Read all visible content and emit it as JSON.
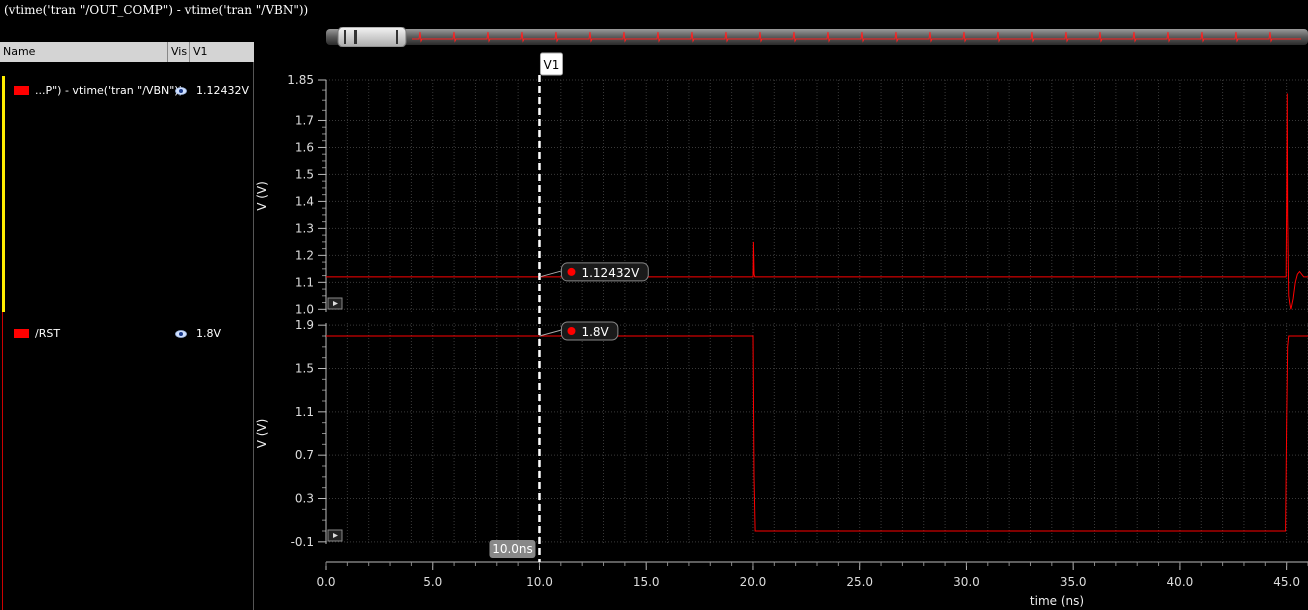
{
  "window": {
    "title": "(vtime('tran \"/OUT_COMP\") - vtime('tran \"/VBN\"))"
  },
  "browser": {
    "columns": [
      "Name",
      "Vis",
      "V1"
    ],
    "traces": [
      {
        "name": "...P\") - vtime('tran \"/VBN\"))",
        "value": "1.12432V",
        "color": "#ff0000",
        "visible_icon": "eye-icon"
      },
      {
        "name": "/RST",
        "value": "1.8V",
        "color": "#ff0000",
        "visible_icon": "eye-icon"
      }
    ]
  },
  "cursor": {
    "label": "V1",
    "time_label": "10.0ns",
    "time": 10.0,
    "readouts": [
      "1.12432V",
      "1.8V"
    ]
  },
  "colors": {
    "trace": "#ff0000",
    "grid": "#3a3a3a",
    "cursor": "#ffffff",
    "background": "#000000"
  },
  "chart_data": [
    {
      "type": "line",
      "ylabel": "V (V)",
      "xlim": [
        0,
        46
      ],
      "ylim": [
        0.99,
        1.85
      ],
      "yticks": [
        "1.0",
        "1.1",
        "1.2",
        "1.3",
        "1.4",
        "1.5",
        "1.6",
        "1.7",
        "1.85"
      ],
      "ytick_values": [
        1.0,
        1.1,
        1.2,
        1.3,
        1.4,
        1.5,
        1.6,
        1.7,
        1.85
      ],
      "grid": true,
      "series": [
        {
          "x": [
            0,
            20.0,
            20.02,
            20.05,
            20.08,
            20.1,
            44.98,
            45.0,
            45.03,
            45.05,
            45.08,
            45.1,
            45.15,
            45.2,
            45.3,
            45.4,
            45.5,
            45.6,
            45.8,
            46.0
          ],
          "y": [
            1.12,
            1.12,
            1.25,
            1.13,
            1.12,
            1.12,
            1.12,
            1.4,
            1.8,
            1.35,
            1.15,
            1.05,
            1.02,
            1.0,
            1.04,
            1.1,
            1.13,
            1.14,
            1.12,
            1.12
          ]
        }
      ]
    },
    {
      "type": "line",
      "ylabel": "V (V)",
      "xlabel": "time (ns)",
      "xlim": [
        0,
        46
      ],
      "ylim": [
        -0.12,
        1.92
      ],
      "yticks": [
        "-0.1",
        "0.3",
        "0.7",
        "1.1",
        "1.5",
        "1.9"
      ],
      "ytick_values": [
        -0.1,
        0.3,
        0.7,
        1.1,
        1.5,
        1.9
      ],
      "xticks": [
        "0.0",
        "5.0",
        "10.0",
        "15.0",
        "20.0",
        "25.0",
        "30.0",
        "35.0",
        "40.0",
        "45.0"
      ],
      "xtick_values": [
        0,
        5,
        10,
        15,
        20,
        25,
        30,
        35,
        40,
        45
      ],
      "grid": true,
      "series": [
        {
          "x": [
            0,
            19.95,
            20.0,
            20.05,
            20.1,
            20.15,
            44.9,
            44.95,
            45.0,
            45.05,
            45.1,
            46.0
          ],
          "y": [
            1.8,
            1.8,
            1.8,
            0.5,
            0.0,
            0.0,
            0.0,
            0.0,
            1.0,
            1.7,
            1.8,
            1.8
          ]
        }
      ]
    }
  ]
}
